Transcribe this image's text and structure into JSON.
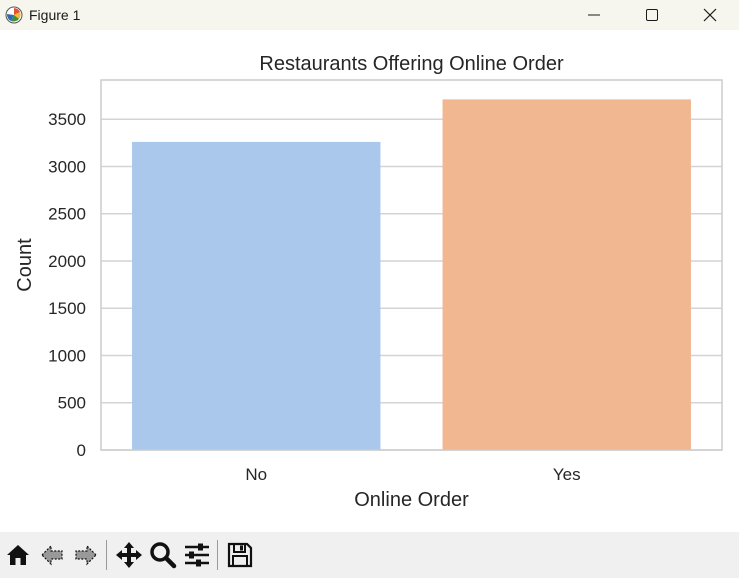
{
  "window": {
    "title": "Figure 1",
    "controls": {
      "minimize": "—",
      "maximize": "☐",
      "close": "✕"
    }
  },
  "toolbar": {
    "icons": [
      "home-icon",
      "back-icon",
      "forward-icon",
      "pan-icon",
      "zoom-icon",
      "configure-subplots-icon",
      "save-icon"
    ]
  },
  "chart_data": {
    "type": "bar",
    "title": "Restaurants Offering Online Order",
    "xlabel": "Online Order",
    "ylabel": "Count",
    "categories": [
      "No",
      "Yes"
    ],
    "values": [
      3260,
      3710
    ],
    "colors": [
      "#a9c8ec",
      "#f1b791"
    ],
    "ylim": [
      0,
      3915
    ],
    "yticks": [
      0,
      500,
      1000,
      1500,
      2000,
      2500,
      3000,
      3500
    ],
    "grid": true,
    "grid_axis": "y"
  }
}
